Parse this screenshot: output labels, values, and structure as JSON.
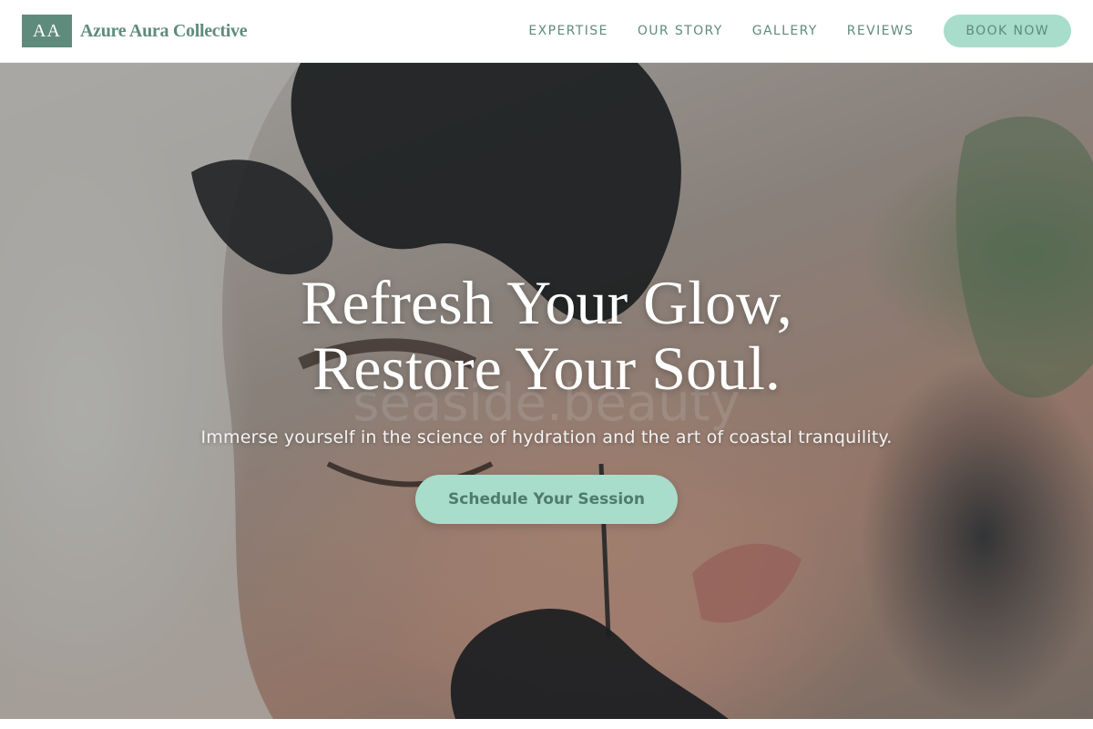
{
  "brand": {
    "logo_initials": "AA",
    "name": "Azure Aura Collective"
  },
  "nav": {
    "items": [
      {
        "label": "EXPERTISE"
      },
      {
        "label": "OUR STORY"
      },
      {
        "label": "GALLERY"
      },
      {
        "label": "REVIEWS"
      }
    ],
    "cta_label": "BOOK NOW"
  },
  "hero": {
    "title_line_1": "Refresh Your Glow,",
    "title_line_2": "Restore Your Soul.",
    "watermark": "seaside.beauty",
    "subtitle": "Immerse yourself in the science of hydration and the art of coastal tranquility.",
    "cta_label": "Schedule Your Session",
    "image_icon": "facial-treatment-photo"
  },
  "colors": {
    "brand_green": "#5f8b7d",
    "accent_mint": "#a8dccb",
    "hero_text": "#ffffff"
  }
}
